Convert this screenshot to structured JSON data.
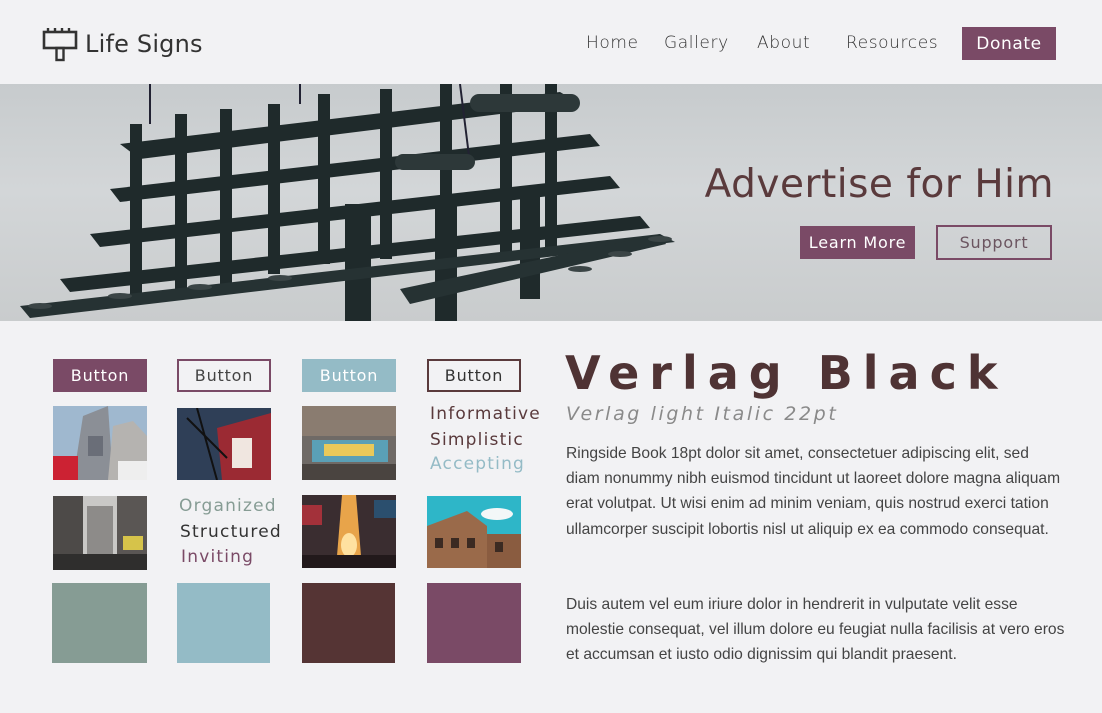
{
  "brand": {
    "name": "Life Signs",
    "icon": "billboard-icon"
  },
  "nav": {
    "home": "Home",
    "gallery": "Gallery",
    "about": "About",
    "resources": "Resources",
    "donate": "Donate"
  },
  "hero": {
    "title": "Advertise for Him",
    "learn_more": "Learn More",
    "support": "Support"
  },
  "style_guide": {
    "buttons": [
      "Button",
      "Button",
      "Button",
      "Button"
    ],
    "words_right": [
      "Informative",
      "Simplistic",
      "Accepting"
    ],
    "words_left": [
      "Organized",
      "Structured",
      "Inviting"
    ],
    "swatches": [
      "#869c94",
      "#94bbc6",
      "#553434",
      "#7a4a66"
    ]
  },
  "typography": {
    "title": "Verlag Black",
    "subtitle": "Verlag light Italic 22pt",
    "paragraph1": "Ringside Book 18pt dolor sit amet, consectetuer adipiscing elit, sed diam nonummy nibh euismod tincidunt ut laoreet dolore magna aliquam erat volutpat. Ut wisi enim ad minim veniam, quis nostrud exerci tation ullamcorper suscipit lobortis nisl ut aliquip ex ea commodo consequat.",
    "paragraph2": "Duis autem vel eum iriure dolor in hendrerit in vulputate velit esse molestie consequat, vel illum dolore eu feugiat nulla facilisis at vero eros et accumsan et iusto odio dignissim qui blandit praesent."
  },
  "colors": {
    "plum": "#7a4a66",
    "dusty_blue": "#94bbc6",
    "sage": "#869c94",
    "brown": "#553434"
  }
}
